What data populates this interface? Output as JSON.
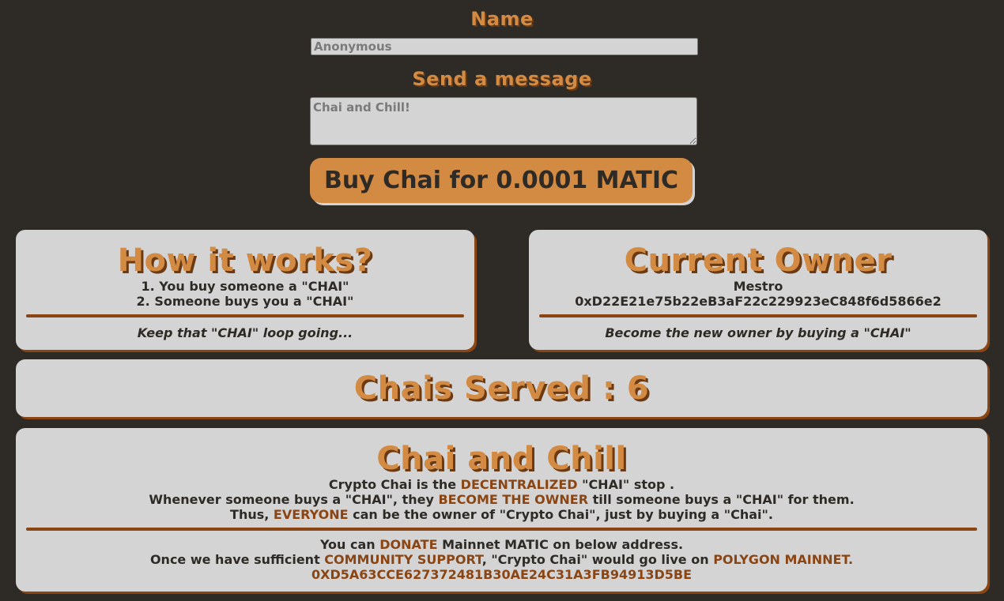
{
  "form": {
    "name_label": "Name",
    "name_placeholder": "Anonymous",
    "message_label": "Send a message",
    "message_placeholder": "Chai and Chill!",
    "buy_button": "Buy Chai for 0.0001 MATIC"
  },
  "how_it_works": {
    "title": "How it works?",
    "steps": [
      "1. You buy someone a \"CHAI\"",
      "2. Someone buys you a \"CHAI\""
    ],
    "tagline": "Keep that \"CHAI\" loop going..."
  },
  "current_owner": {
    "title": "Current Owner",
    "name": "Mestro",
    "address": "0xD22E21e75b22eB3aF22c229923eC848f6d5866e2",
    "tagline": "Become the new owner by buying a \"CHAI\""
  },
  "served": {
    "text": "Chais Served : 6"
  },
  "about": {
    "title": "Chai and Chill",
    "line1_a": "Crypto Chai is the ",
    "line1_hl": "DECENTRALIZED",
    "line1_b": " \"CHAI\" stop .",
    "line2_a": "Whenever someone buys a \"CHAI\", they ",
    "line2_hl": "BECOME THE OWNER",
    "line2_b": " till someone buys a \"CHAI\" for them.",
    "line3_a": "Thus, ",
    "line3_hl": "EVERYONE",
    "line3_b": " can be the owner of \"Crypto Chai\", just by buying a \"Chai\".",
    "donate_a": "You can ",
    "donate_hl": "DONATE",
    "donate_b": " Mainnet MATIC on below address.",
    "support_a": "Once we have sufficient ",
    "support_hl1": "COMMUNITY SUPPORT",
    "support_b": ", \"Crypto Chai\" would go live on ",
    "support_hl2": "POLYGON MAINNET.",
    "donate_address": "0XD5A63CCE627372481B30AE24C31A3FB94913D5BE"
  },
  "colors": {
    "background": "#2e2b27",
    "accent": "#d38a42",
    "card": "#d4d4d4",
    "highlight": "#8b4513"
  }
}
